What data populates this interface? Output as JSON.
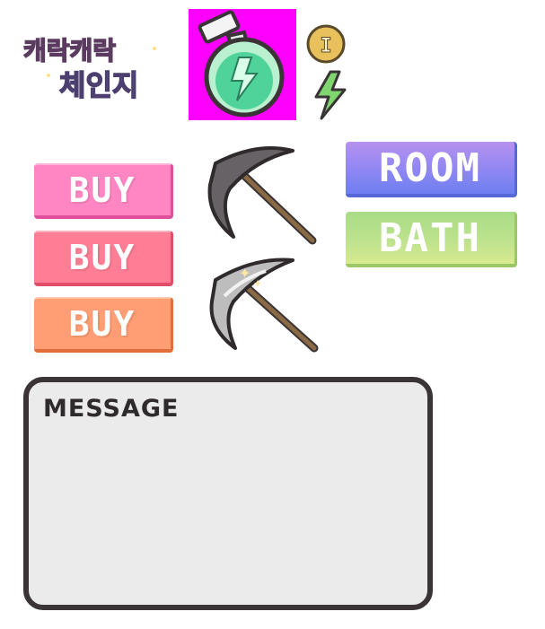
{
  "logo": {
    "line1": "캐락캐락",
    "line2": "체인지"
  },
  "coin": {
    "glyph": "I"
  },
  "shop": {
    "buy_labels": [
      "BUY",
      "BUY",
      "BUY"
    ],
    "colors": [
      "#ff86c3",
      "#ff7e95",
      "#ff9e74"
    ]
  },
  "nav": {
    "room_label": "ROOM",
    "bath_label": "BATH"
  },
  "message": {
    "title": "MESSAGE"
  }
}
